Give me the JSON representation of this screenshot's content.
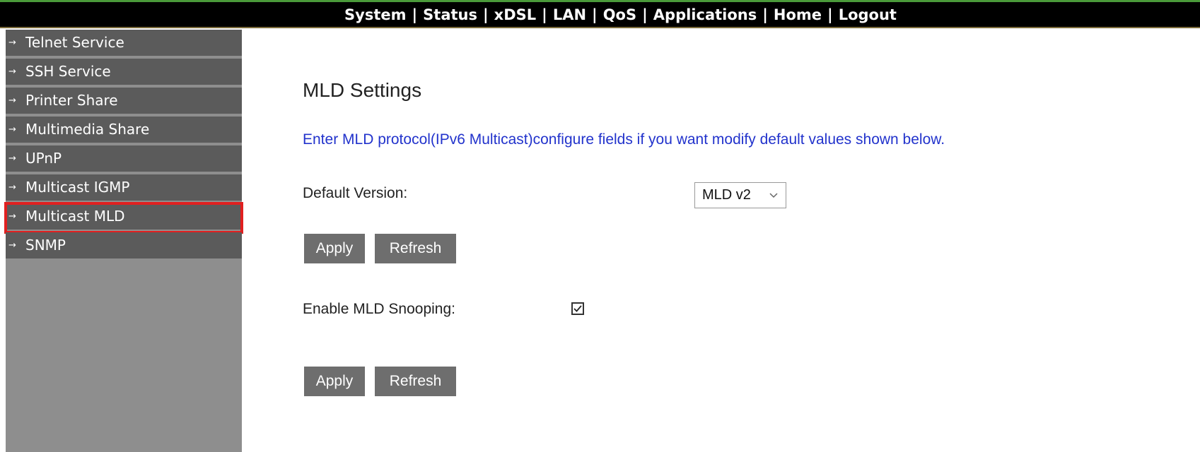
{
  "topnav": {
    "items": [
      "System",
      "Status",
      "xDSL",
      "LAN",
      "QoS",
      "Applications",
      "Home",
      "Logout"
    ],
    "separator": "|"
  },
  "sidebar": {
    "arrow": "→",
    "items": [
      {
        "label": "Telnet Service"
      },
      {
        "label": "SSH Service"
      },
      {
        "label": "Printer Share"
      },
      {
        "label": "Multimedia Share"
      },
      {
        "label": "UPnP"
      },
      {
        "label": "Multicast IGMP"
      },
      {
        "label": "Multicast MLD",
        "active": true
      },
      {
        "label": "SNMP"
      }
    ]
  },
  "main": {
    "title": "MLD Settings",
    "info": "Enter MLD protocol(IPv6 Multicast)configure fields if you want modify default values shown below.",
    "default_version_label": "Default Version:",
    "default_version_value": "MLD v2",
    "apply_label": "Apply",
    "refresh_label": "Refresh",
    "snooping_label": "Enable MLD Snooping:",
    "snooping_checked": true
  },
  "colors": {
    "active_outline": "#e02020",
    "info_text": "#2233cc",
    "sidebar_item": "#5b5b5b",
    "sidebar_bg": "#8e8e8e"
  },
  "icons": {
    "sidebar_arrow": "arrow-right-icon",
    "select_chevron": "chevron-down-icon",
    "checkbox": "checkmark-icon"
  }
}
